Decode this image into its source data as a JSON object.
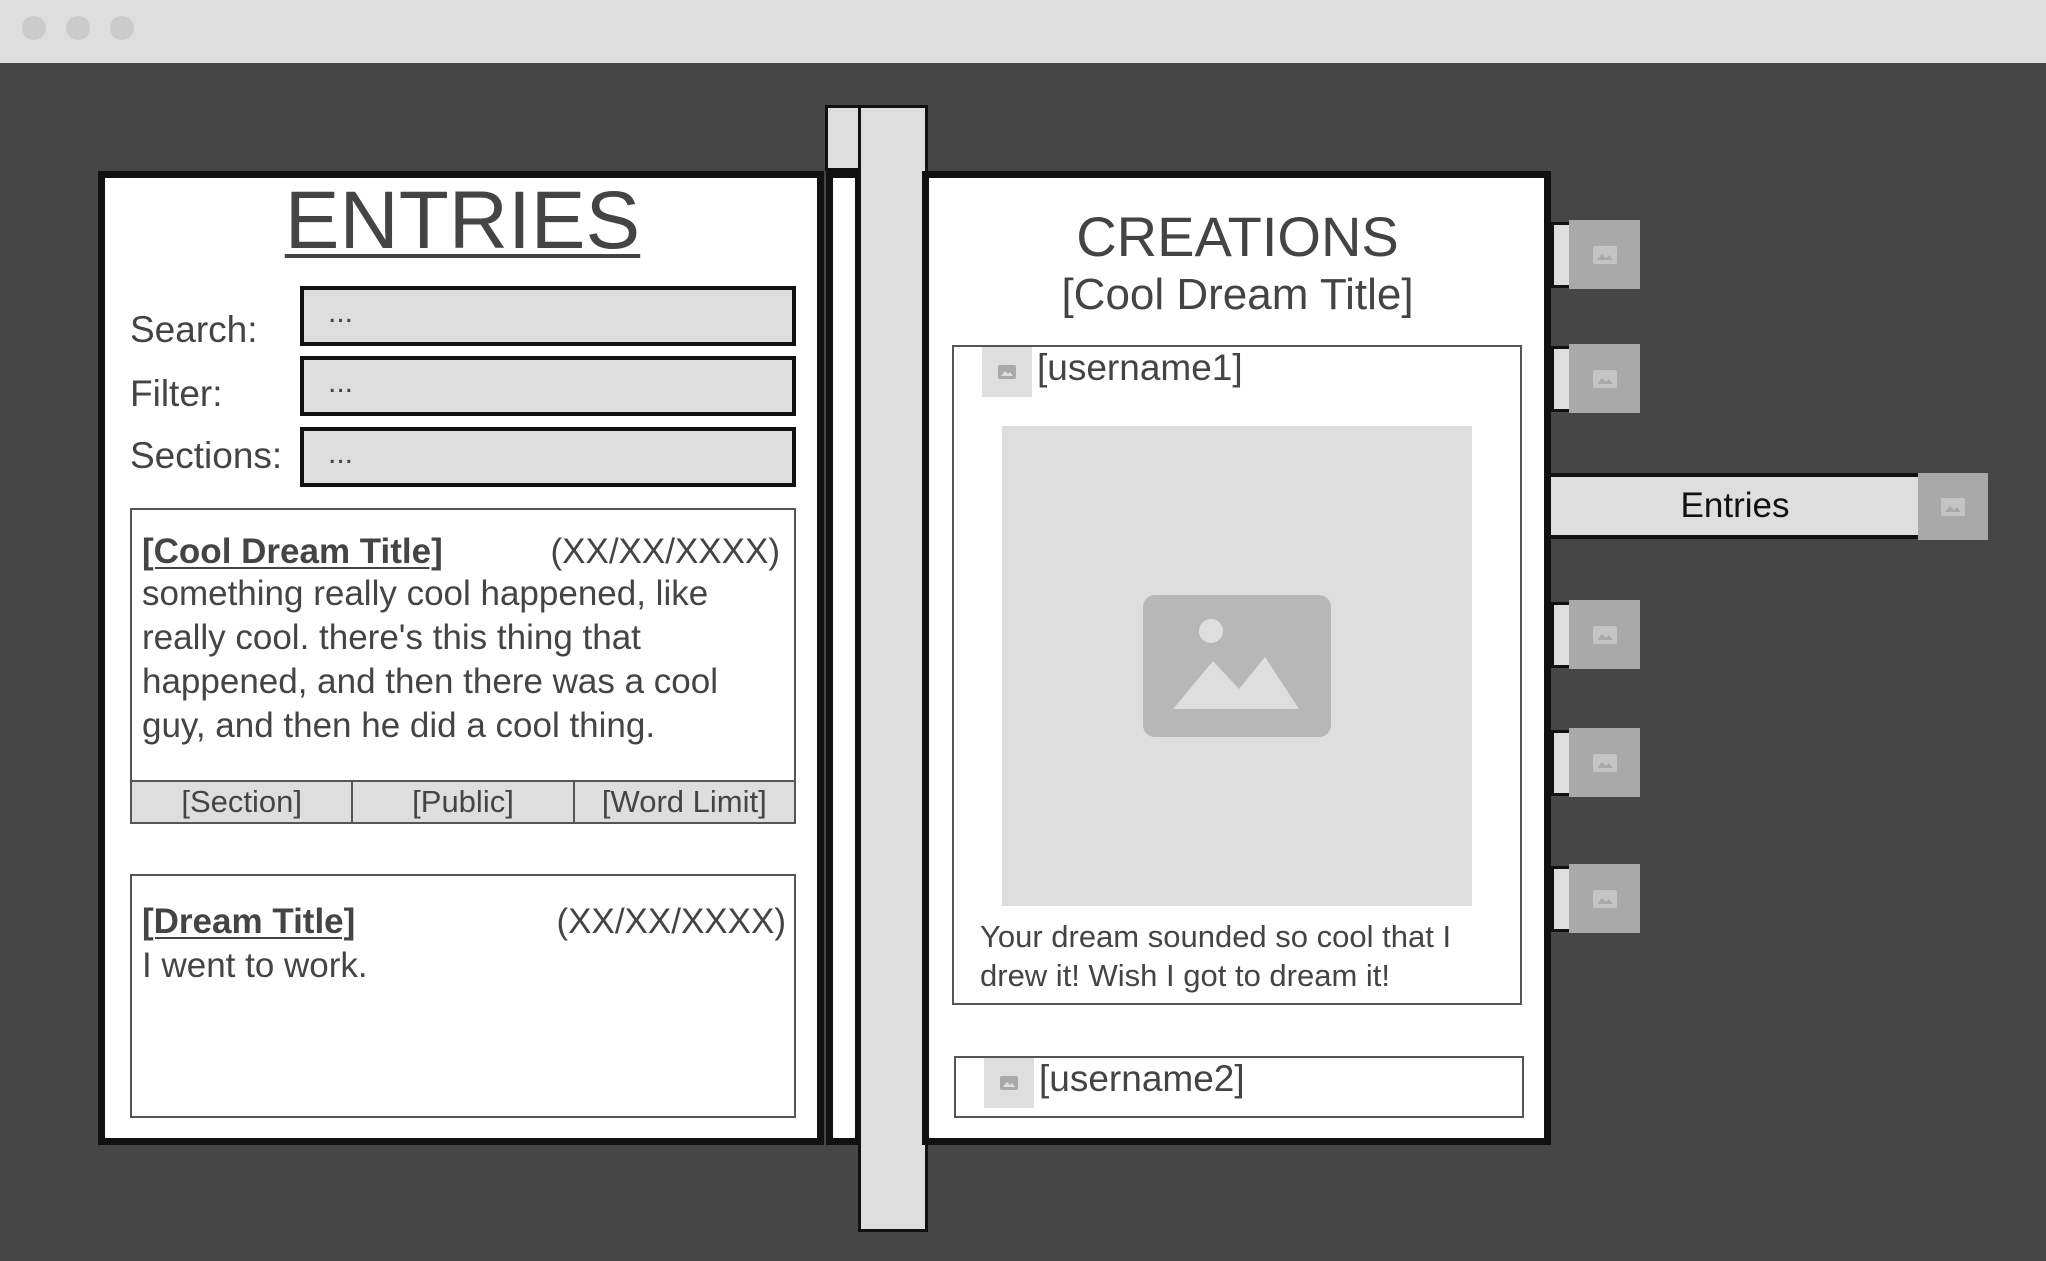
{
  "window": {
    "controls": [
      "close-dot",
      "minimize-dot",
      "maximize-dot"
    ]
  },
  "entries_page": {
    "title": "ENTRIES",
    "search": {
      "label": "Search:",
      "value": "..."
    },
    "filter": {
      "label": "Filter:",
      "value": "..."
    },
    "sections": {
      "label": "Sections:",
      "value": "..."
    },
    "entries": [
      {
        "title": "[Cool Dream Title]",
        "date": "(XX/XX/XXXX)",
        "body": "something really cool happened, like really cool. there's this thing that happened, and then there was a cool guy, and then he did a cool thing.",
        "tags": [
          "[Section]",
          "[Public]",
          "[Word Limit]"
        ]
      },
      {
        "title": "[Dream Title]",
        "date": "(XX/XX/XXXX)",
        "body": "I went to work."
      }
    ]
  },
  "creations_page": {
    "title": "CREATIONS",
    "subtitle": "[Cool Dream Title]",
    "posts": [
      {
        "username": "[username1]",
        "caption": "Your dream sounded so cool that I drew it! Wish I got to dream it!"
      },
      {
        "username": "[username2]"
      }
    ]
  },
  "side_tabs": {
    "active_label": "Entries",
    "icon": "image-placeholder-icon"
  },
  "colors": {
    "background": "#464646",
    "page": "#ffffff",
    "panel_gray": "#dedede",
    "icon_gray": "#a9a9a9",
    "border": "#111111"
  }
}
